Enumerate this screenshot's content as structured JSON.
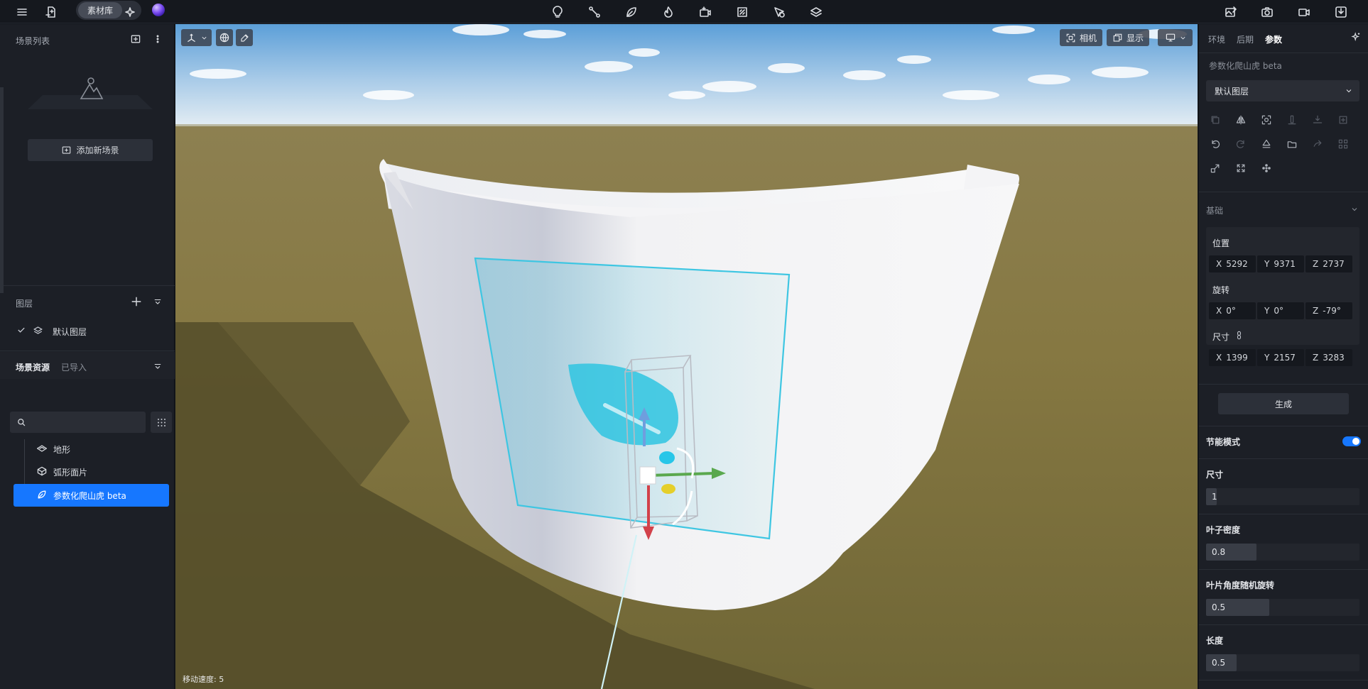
{
  "topbar": {
    "library_label": "素材库",
    "icons": [
      "menu-icon",
      "import-file-icon",
      "ai-sparkle-icon",
      "light-bulb-icon",
      "path-icon",
      "leaf-icon",
      "fire-icon",
      "camera-add-icon",
      "panel-icon",
      "cursor-add-icon",
      "layers-icon",
      "image-edit-icon",
      "camera-icon",
      "video-icon",
      "save-icon"
    ]
  },
  "left": {
    "scene_list_title": "场景列表",
    "add_scene_label": "添加新场景",
    "layers_title": "图层",
    "default_layer": "默认图层",
    "assets_tab": "场景资源",
    "imported_tab": "已导入",
    "search_placeholder": "",
    "tree": [
      {
        "label": "地形",
        "icon": "terrain-icon",
        "selected": false
      },
      {
        "label": "弧形面片",
        "icon": "cube-icon",
        "selected": false
      },
      {
        "label": "参数化爬山虎 beta",
        "icon": "leaf-icon",
        "selected": true
      }
    ]
  },
  "viewport": {
    "camera_label": "相机",
    "display_label": "显示",
    "move_speed": "移动速度: 5"
  },
  "right": {
    "tabs": [
      {
        "label": "环境",
        "active": false
      },
      {
        "label": "后期",
        "active": false
      },
      {
        "label": "参数",
        "active": true
      }
    ],
    "object_name": "参数化爬山虎 beta",
    "layer_select": "默认图层",
    "basic_title": "基础",
    "position_label": "位置",
    "position": {
      "x": "5292",
      "y": "9371",
      "z": "2737"
    },
    "rotation_label": "旋转",
    "rotation": {
      "x": "0°",
      "y": "0°",
      "z": "-79°"
    },
    "size_label": "尺寸",
    "size": {
      "x": "1399",
      "y": "2157",
      "z": "3283"
    },
    "generate_label": "生成",
    "energy_mode_label": "节能模式",
    "energy_mode_on": true,
    "params": [
      {
        "label": "尺寸",
        "value": "1",
        "fraction": 0.07
      },
      {
        "label": "叶子密度",
        "value": "0.8",
        "fraction": 0.33
      },
      {
        "label": "叶片角度随机旋转",
        "value": "0.5",
        "fraction": 0.41
      },
      {
        "label": "长度",
        "value": "0.5",
        "fraction": 0.2
      }
    ]
  },
  "colors": {
    "accent": "#1677ff",
    "panel": "#1c1f26",
    "topbar": "#15181e",
    "gizmo_x": "#5aa84e",
    "gizmo_y": "#3e7dd6",
    "gizmo_z": "#d2414a",
    "selection": "#34c3e0"
  },
  "axis_labels": {
    "x": "X",
    "y": "Y",
    "z": "Z"
  }
}
